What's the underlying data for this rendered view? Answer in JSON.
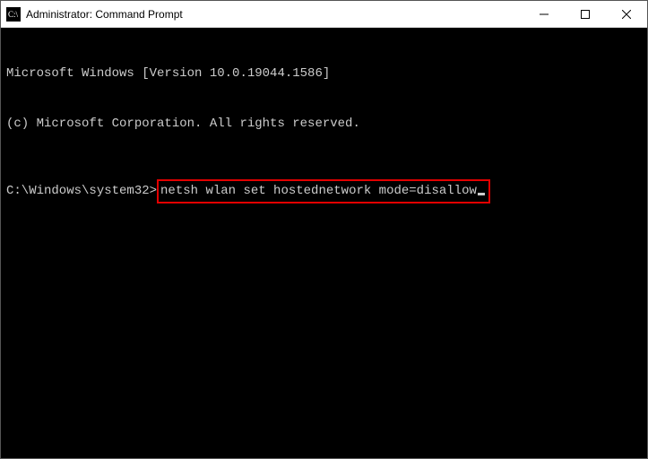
{
  "titlebar": {
    "title": "Administrator: Command Prompt"
  },
  "terminal": {
    "banner_line1": "Microsoft Windows [Version 10.0.19044.1586]",
    "banner_line2": "(c) Microsoft Corporation. All rights reserved.",
    "prompt": "C:\\Windows\\system32>",
    "command": "netsh wlan set hostednetwork mode=disallow"
  },
  "highlight": {
    "color": "#e20000"
  }
}
